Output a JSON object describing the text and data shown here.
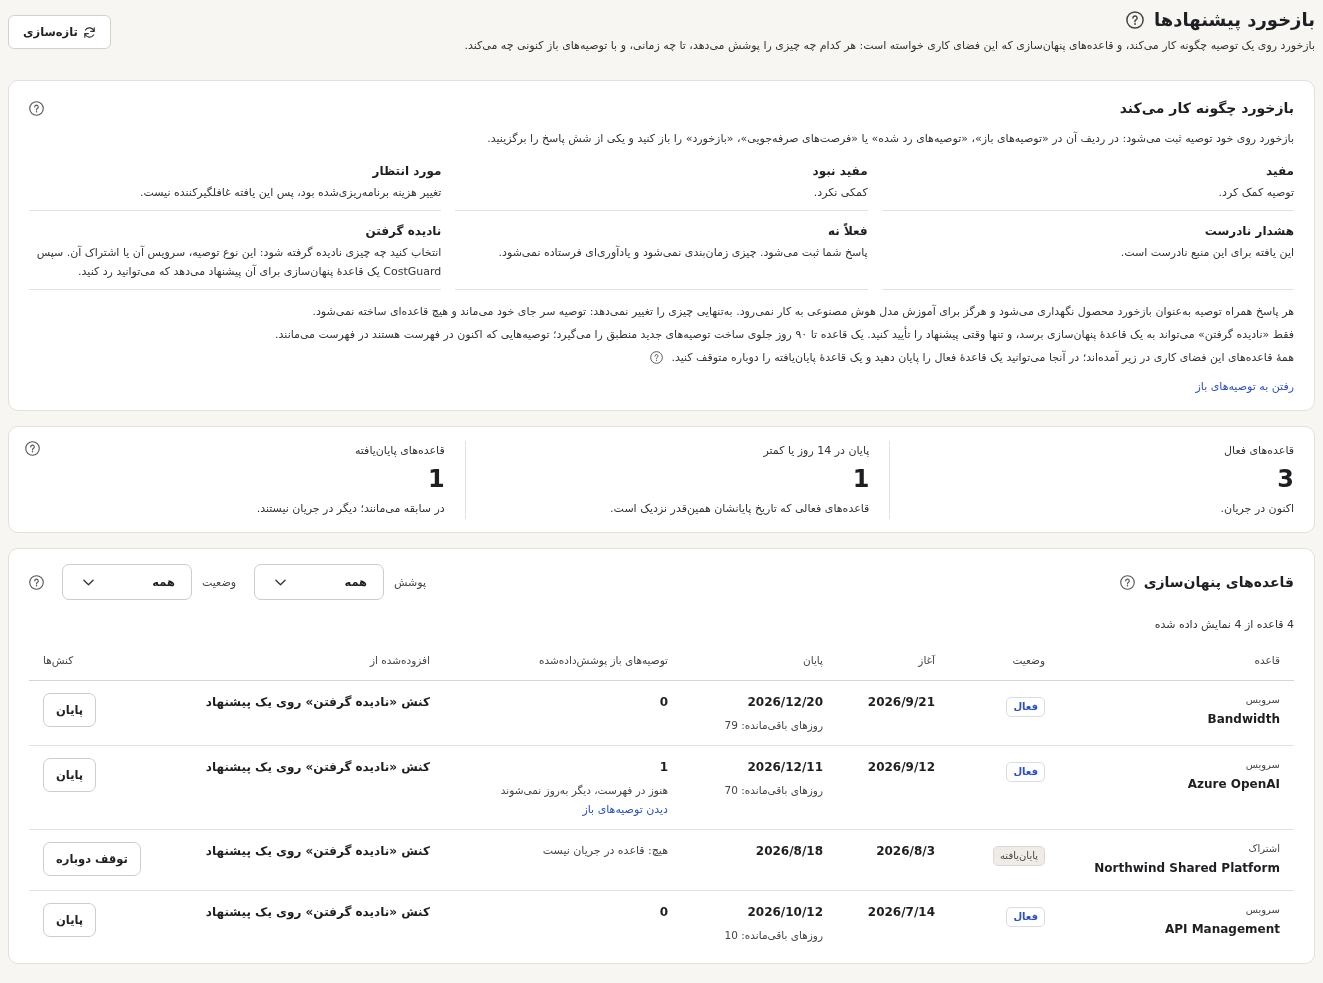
{
  "header": {
    "title": "بازخورد پیشنهادها",
    "subtitle": "بازخورد روی یک توصیه چگونه کار می‌کند، و قاعده‌های پنهان‌سازی که این فضای کاری خواسته است: هر کدام چه چیزی را پوشش می‌دهد، تا چه زمانی، و با توصیه‌های باز کنونی چه می‌کند.",
    "refresh_button": "تازه‌سازی"
  },
  "how_it_works": {
    "title": "بازخورد چگونه کار می‌کند",
    "intro": "بازخورد روی خود توصیه ثبت می‌شود: در ردیف آن در «توصیه‌های باز»، «توصیه‌های رد شده» یا «فرصت‌های صرفه‌جویی»، «بازخورد» را باز کنید و یکی از شش پاسخ را برگزینید.",
    "outcomes": [
      {
        "title": "مفید",
        "description": "توصیه کمک کرد."
      },
      {
        "title": "مفید نبود",
        "description": "کمکی نکرد."
      },
      {
        "title": "مورد انتظار",
        "description": "تغییر هزینه برنامه‌ریزی‌شده بود، پس این یافته غافلگیرکننده نیست."
      },
      {
        "title": "هشدار نادرست",
        "description": "این یافته برای این منبع نادرست است."
      },
      {
        "title": "فعلاً نه",
        "description": "پاسخ شما ثبت می‌شود. چیزی زمان‌بندی نمی‌شود و یادآوری‌ای فرستاده نمی‌شود."
      },
      {
        "title": "نادیده گرفتن",
        "description": "انتخاب کنید چه چیزی نادیده گرفته شود: این نوع توصیه، سرویس آن یا اشتراک آن. سپس CostGuard یک قاعدهٔ پنهان‌سازی برای آن پیشنهاد می‌دهد که می‌توانید رد کنید."
      }
    ],
    "notes": [
      "هر پاسخ همراه توصیه به‌عنوان بازخورد محصول نگهداری می‌شود و هرگز برای آموزش مدل هوش مصنوعی به کار نمی‌رود. به‌تنهایی چیزی را تغییر نمی‌دهد: توصیه سر جای خود می‌ماند و هیچ قاعده‌ای ساخته نمی‌شود.",
      "فقط «نادیده گرفتن» می‌تواند به یک قاعدهٔ پنهان‌سازی برسد، و تنها وقتی پیشنهاد را تأیید کنید. یک قاعده تا ۹۰ روز جلوی ساخت توصیه‌های جدید منطبق را می‌گیرد؛ توصیه‌هایی که اکنون در فهرست هستند در فهرست می‌مانند.",
      "همهٔ قاعده‌های این فضای کاری در زیر آمده‌اند؛ در آنجا می‌توانید یک قاعدهٔ فعال را پایان دهید و یک قاعدهٔ پایان‌یافته را دوباره متوقف کنید."
    ],
    "link": "رفتن به توصیه‌های باز"
  },
  "stats": [
    {
      "label": "قاعده‌های فعال",
      "value": "3",
      "description": "اکنون در جریان."
    },
    {
      "label": "پایان در 14 روز یا کمتر",
      "value": "1",
      "description": "قاعده‌های فعالی که تاریخ پایانشان همین‌قدر نزدیک است."
    },
    {
      "label": "قاعده‌های پایان‌یافته",
      "value": "1",
      "description": "در سابقه می‌مانند؛ دیگر در جریان نیستند."
    }
  ],
  "rules": {
    "title": "قاعده‌های پنهان‌سازی",
    "filters": [
      {
        "label": "پوشش",
        "value": "همه"
      },
      {
        "label": "وضعیت",
        "value": "همه"
      }
    ],
    "count": "4 قاعده از 4 نمایش داده شده",
    "columns": [
      "قاعده",
      "وضعیت",
      "آغاز",
      "پایان",
      "توصیه‌های باز پوشش‌داده‌شده",
      "افزوده‌شده از",
      "کنش‌ها"
    ],
    "rows": [
      {
        "type": "سرویس",
        "name": "Bandwidth",
        "status": {
          "label": "فعال",
          "kind": "active"
        },
        "start": "2026/9/21",
        "end": "2026/12/20",
        "remaining": "روزهای باقی‌مانده: 79",
        "covered": {
          "kind": "count",
          "text": "0"
        },
        "added_from": "کنش «نادیده گرفتن» روی یک پیشنهاد",
        "action": "پایان"
      },
      {
        "type": "سرویس",
        "name": "Azure OpenAI",
        "status": {
          "label": "فعال",
          "kind": "active"
        },
        "start": "2026/9/12",
        "end": "2026/12/11",
        "remaining": "روزهای باقی‌مانده: 70",
        "covered": {
          "kind": "count",
          "text": "1",
          "note": "هنوز در فهرست، دیگر به‌روز نمی‌شوند",
          "link": "دیدن توصیه‌های باز"
        },
        "added_from": "کنش «نادیده گرفتن» روی یک پیشنهاد",
        "action": "پایان"
      },
      {
        "type": "اشتراک",
        "name": "Northwind Shared Platform",
        "status": {
          "label": "پایان‌یافته",
          "kind": "ended"
        },
        "start": "2026/8/3",
        "end": "2026/8/18",
        "covered": {
          "kind": "none",
          "text": "هیچ: قاعده در جریان نیست"
        },
        "added_from": "کنش «نادیده گرفتن» روی یک پیشنهاد",
        "action": "توقف دوباره"
      },
      {
        "type": "سرویس",
        "name": "API Management",
        "status": {
          "label": "فعال",
          "kind": "active"
        },
        "start": "2026/7/14",
        "end": "2026/10/12",
        "remaining": "روزهای باقی‌مانده: 10",
        "covered": {
          "kind": "count",
          "text": "0"
        },
        "added_from": "کنش «نادیده گرفتن» روی یک پیشنهاد",
        "action": "پایان"
      }
    ]
  }
}
